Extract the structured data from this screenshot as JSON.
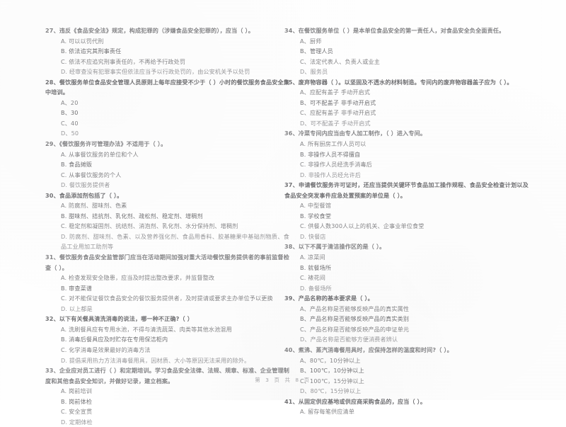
{
  "document": {
    "kind": "scanned-exam-paper",
    "language": "zh-CN",
    "footer": "第 3 页 共 8 页"
  },
  "columns": {
    "left": [
      {
        "number": "27",
        "stem": "27、违反《食品安全法》规定，构成犯罪的（涉嫌食品安全犯罪的），应当（        ）。",
        "options": [
          "A. 可以以罚代刑",
          "B. 依法追究其刑事责任",
          "C. 依法不应追究刑事责任的，不再给予行政处罚",
          "D. 经审查没有犯罪事实但依法应当予以行政处罚的，由公安机关予以处罚"
        ]
      },
      {
        "number": "28",
        "stem": "28、餐饮服务单位食品安全管理人员原则上每年应接受不少于（        ）小时的餐饮服务食品安全集中培训。",
        "options": [
          "A、20",
          "B、30",
          "C、40",
          "D、50"
        ]
      },
      {
        "number": "29",
        "stem": "29、《餐饮服务许可管理办法》不适用于（        ）。",
        "options": [
          "A. 从事餐饮服务的单位和个人",
          "B. 食品摊贩",
          "C. 从事餐饮服务的个人",
          "D. 餐饮服务提供者"
        ]
      },
      {
        "number": "30",
        "stem": "30、食品添加剂包括了（        ）。",
        "options": [
          "A. 防腐剂、甜味剂、色素",
          "B. 甜味剂、拮抗剂、乳化剂、疏松剂、稳定剂、增稠剂",
          "C. 稳定剂和凝固剂、抗结剂、消泡剂、乳化剂、水分保持剂、增稠剂",
          "D. 防腐剂、甜味剂、色素、以及营养强化剂、食品用香料、胶基糖果中基础剂物质、食品工业用加工助剂等"
        ]
      },
      {
        "number": "31",
        "stem": "31、餐饮服务食品安全监管部门应当在活动期间加强对重大活动餐饮服务提供者的事前监督检查（        ）。",
        "options": [
          "A. 检查发现安全隐患，应当及时提出整改要求，并监督整改",
          "B. 审查菜谱",
          "C. 对不能保证餐饮食品安全的餐饮服务提供者，及时提请或要求主办单位予以更换",
          "D. 以上都是"
        ]
      },
      {
        "number": "32",
        "stem": "32、以下有关餐具清洗消毒的说法，哪一种不正确?（        ）",
        "options": [
          "A. 洗刷餐具应有专用水池，不得与清洗蔬菜、肉类等其他水池混用",
          "B. 消毒后餐具应及时贮存在专用保洁柜内",
          "C. 化学消毒是效果最好的消毒方法",
          "D. 提倡采用热力方法消毒餐用具，因材质、大小等原因无法采用的除外。"
        ]
      },
      {
        "number": "33",
        "stem": "33、企业应对员工进行（        ）和定期培训。学习食品安全法律、法规、规章、标准、企业管理制度和其他食品安全知识，并做好记录，建立档案。",
        "options": [
          "A. 岗前培训",
          "B. 岗前体检",
          "C. 安全宣贯",
          "D. 定期体检"
        ]
      }
    ],
    "right": [
      {
        "number": "34",
        "stem": "34、在餐饮服务单位（        ）是本单位食品安全的第一责任人，对食品安全负全面责任。",
        "options": [
          "A、厨师",
          "B、管理人员",
          "C、法定代表人、负责人或业主",
          "D、服务员"
        ]
      },
      {
        "number": "35",
        "stem": "35、废弃物容器（            ）。以坚固及不透水的材料制造。专间内的废弃物容器盖子应为（        ）。",
        "options": [
          "A、应配有盖子  手动开启式",
          "B、可不配盖子  非手动开启式",
          "C、应配有盖子  非手动开启式",
          "D、可不配盖子  手动开启式"
        ]
      },
      {
        "number": "36",
        "stem": "36、冷菜专间内应当由专人加工制作，（        ）进入专间。",
        "options": [
          "A. 所有厨房工作人员可以",
          "B. 非操作人员不得擅自",
          "C. 非操作人员经洗手消毒后",
          "D. 非操作人员经允许后"
        ]
      },
      {
        "number": "37",
        "stem": "37、申请餐饮服务许可证时，还应当提供关键环节食品加工操作规程、食品安全检查计划以及食品安全突发事件应急处置预案的单位是（        ）。",
        "options": [
          "A. 中型餐馆",
          "B. 学校食堂",
          "C. 供餐人数300人以上的机关、企事业单位食堂",
          "D. 快餐店"
        ]
      },
      {
        "number": "38",
        "stem": "38、以下不属于清洁操作区的是（        ）。",
        "options": [
          "A. 凉菜间",
          "B. 就餐场所",
          "C. 裱花间",
          "D. 备餐场所"
        ]
      },
      {
        "number": "39",
        "stem": "39、产品名称的基本要求是（        ）。",
        "options": [
          "A、产品名称是否能够反映产品的真实属性",
          "B、产品名称是否能够反映产品的真实类别",
          "C、产品名称是否能够反映产品的申证单元",
          "D、产品名称是否能够方便消费者辨认"
        ]
      },
      {
        "number": "40",
        "stem": "40、煮沸、蒸汽消毒餐用具时，应保持怎样的温度和时间?（        ）。",
        "options": [
          "A、80℃，10分钟以上",
          "B、100℃，10分钟以上",
          "C、100℃，15分钟以上",
          "D、80℃，15分钟以上"
        ]
      },
      {
        "number": "41",
        "stem": "41、从固定供应基地或供应商采购食品的，应当（        ）。",
        "options": [
          "A. 留存每笔供应清单"
        ]
      }
    ]
  }
}
